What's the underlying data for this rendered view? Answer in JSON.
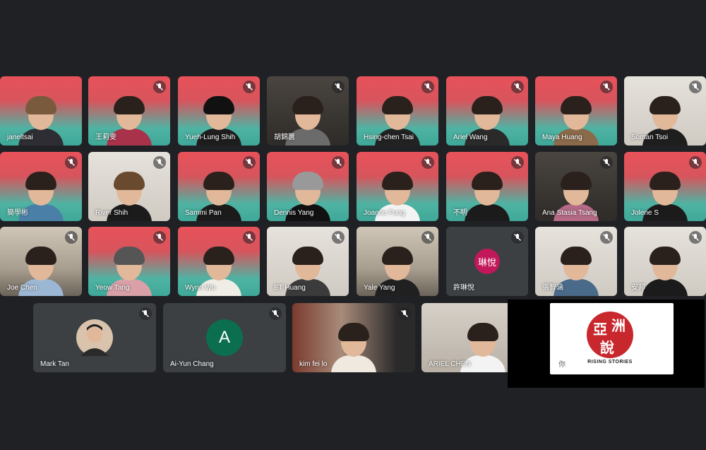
{
  "participants_row1": [
    {
      "name": "janeltsai",
      "bg": "grad",
      "muted": false
    },
    {
      "name": "王莉雯",
      "bg": "grad",
      "muted": true
    },
    {
      "name": "Yueh-Lung Shih",
      "bg": "grad",
      "muted": true
    },
    {
      "name": "胡錦篋",
      "bg": "dark",
      "muted": true
    },
    {
      "name": "Hsing-chen Tsai",
      "bg": "grad",
      "muted": true
    },
    {
      "name": "Ariel Wang",
      "bg": "grad",
      "muted": true
    },
    {
      "name": "Maya Huang",
      "bg": "grad",
      "muted": true
    },
    {
      "name": "Soman Tsoi",
      "bg": "light",
      "muted": true
    }
  ],
  "participants_row2": [
    {
      "name": "簡學彬",
      "bg": "grad",
      "muted": true
    },
    {
      "name": "River Shih",
      "bg": "light",
      "muted": true
    },
    {
      "name": "Sammi Pan",
      "bg": "grad",
      "muted": true
    },
    {
      "name": "Dennis Yang",
      "bg": "grad",
      "muted": true
    },
    {
      "name": "Joanne Fung",
      "bg": "grad",
      "muted": true
    },
    {
      "name": "不明",
      "bg": "grad",
      "muted": true
    },
    {
      "name": "Ana Stasia Tsang",
      "bg": "dark",
      "muted": true
    },
    {
      "name": "Jolene S",
      "bg": "grad",
      "muted": true
    }
  ],
  "participants_row3": [
    {
      "name": "Joe Chen",
      "bg": "room",
      "muted": true
    },
    {
      "name": "Yeow Tang",
      "bg": "grad",
      "muted": true
    },
    {
      "name": "Wynn Wu",
      "bg": "grad",
      "muted": true
    },
    {
      "name": "ET Huang",
      "bg": "light",
      "muted": true
    },
    {
      "name": "Yale Yang",
      "bg": "room",
      "muted": true
    },
    {
      "name": "許琳悅",
      "bg": "gray",
      "muted": true,
      "avatar_text": "琳悅",
      "avatar_color": "#c2185b"
    },
    {
      "name": "張智涵",
      "bg": "light",
      "muted": true
    },
    {
      "name": "安邦",
      "bg": "light",
      "muted": true
    }
  ],
  "participants_row4": [
    {
      "name": "Mark Tan",
      "muted": true,
      "avatar": "photo"
    },
    {
      "name": "Ai-Yun Chang",
      "muted": true,
      "avatar_text": "A",
      "avatar_color": "#0b6e4f"
    },
    {
      "name": "kim fei lo",
      "muted": true
    },
    {
      "name": "ARIEL CHEN",
      "muted": true
    }
  ],
  "presentation": {
    "logo_chars": [
      "亞",
      "洲",
      "說"
    ],
    "logo_caption": "RISING STORIES",
    "self_label": "你"
  },
  "colors": {
    "background": "#202124",
    "tile": "#3c4043",
    "brand_red": "#c8272d"
  }
}
